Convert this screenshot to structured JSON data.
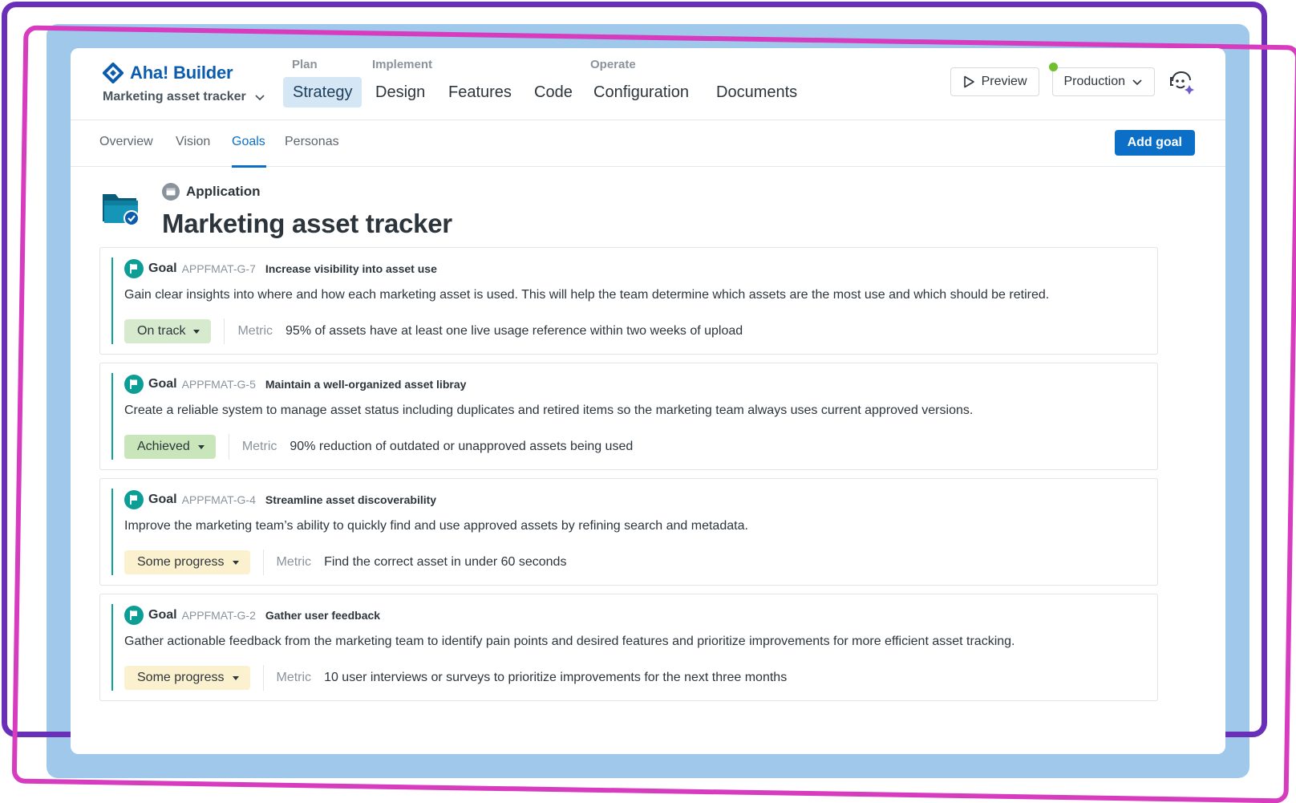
{
  "brand": {
    "name": "Aha! Builder"
  },
  "app_switcher": {
    "label": "Marketing asset tracker"
  },
  "nav": {
    "groups": {
      "plan": "Plan",
      "implement": "Implement",
      "operate": "Operate"
    },
    "items": [
      "Strategy",
      "Design",
      "Features",
      "Code",
      "Configuration",
      "Documents"
    ],
    "active": "Strategy"
  },
  "actions": {
    "preview": "Preview",
    "environment": "Production"
  },
  "subnav": {
    "tabs": [
      "Overview",
      "Vision",
      "Goals",
      "Personas"
    ],
    "active": "Goals",
    "add_button": "Add goal"
  },
  "record": {
    "type": "Application",
    "title": "Marketing asset tracker"
  },
  "metric_label": "Metric",
  "goal_kind": "Goal",
  "goals": [
    {
      "id": "APPFMAT-G-7",
      "name": "Increase visibility into asset use",
      "description": "Gain clear insights into where and how each marketing asset is used. This will help the team determine which assets are the most use and which should be retired.",
      "status": "On track",
      "metric": "95% of assets have at least one live usage reference within two weeks of upload"
    },
    {
      "id": "APPFMAT-G-5",
      "name": "Maintain a well-organized asset libray",
      "description": "Create a reliable system to manage asset status including duplicates and retired items so the marketing team always uses current approved versions.",
      "status": "Achieved",
      "metric": "90% reduction of outdated or unapproved assets being used"
    },
    {
      "id": "APPFMAT-G-4",
      "name": "Streamline asset discoverability",
      "description": "Improve the marketing team’s ability to quickly find and use approved assets by refining search and metadata.",
      "status": "Some progress",
      "metric": "Find the correct asset in under 60 seconds"
    },
    {
      "id": "APPFMAT-G-2",
      "name": "Gather user feedback",
      "description": "Gather actionable feedback from the marketing team to identify pain points and desired features and prioritize improvements for more efficient asset tracking.",
      "status": "Some progress",
      "metric": "10 user interviews or surveys to prioritize improvements for the next three months"
    }
  ],
  "colors": {
    "brand": "#0b5cad",
    "primary": "#0b6fc7",
    "goal_accent": "#0aa39a",
    "status_on_track": "#d6ebcd",
    "status_achieved": "#c9e6bb",
    "status_some_progress": "#fcf1cf",
    "environment_dot": "#6fbf2e"
  }
}
